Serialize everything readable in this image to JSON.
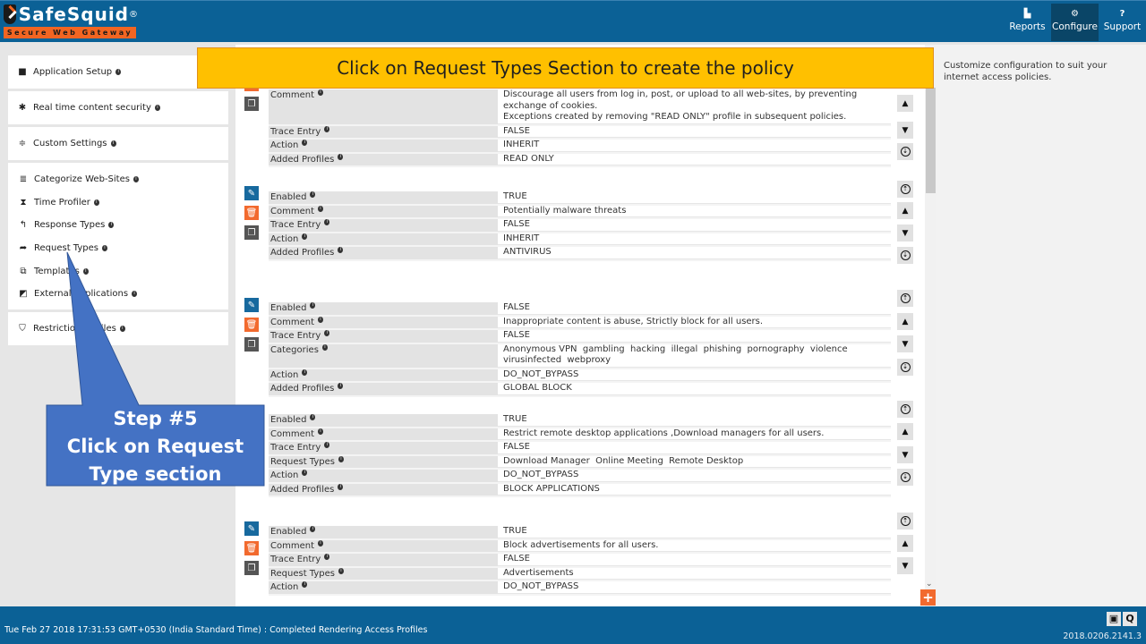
{
  "header": {
    "brand": "SafeSquid",
    "brand_mark": "®",
    "tagline": "Secure Web Gateway",
    "nav": [
      {
        "label": "Reports",
        "icon": "area-chart-icon",
        "glyph": "▙",
        "active": false
      },
      {
        "label": "Configure",
        "icon": "cogs-icon",
        "glyph": "⚙",
        "active": true
      },
      {
        "label": "Support",
        "icon": "question-circle-icon",
        "glyph": "?",
        "active": false
      }
    ]
  },
  "sidebar": {
    "sections": [
      {
        "label": "Application Setup",
        "icon": "briefcase-icon",
        "glyph": "■"
      },
      {
        "label": "Real time content security",
        "icon": "bug-icon",
        "glyph": "✱"
      },
      {
        "label": "Custom Settings",
        "icon": "sliders-icon",
        "glyph": "≑"
      }
    ],
    "sub_items": [
      {
        "label": "Categorize Web-Sites",
        "icon": "database-icon",
        "glyph": "≣"
      },
      {
        "label": "Time Profiler",
        "icon": "hourglass-icon",
        "glyph": "⧗"
      },
      {
        "label": "Response Types",
        "icon": "reply-icon",
        "glyph": "↰"
      },
      {
        "label": "Request Types",
        "icon": "share-icon",
        "glyph": "➦"
      },
      {
        "label": "Templates",
        "icon": "object-group-icon",
        "glyph": "⧉"
      },
      {
        "label": "External applications",
        "icon": "external-link-icon",
        "glyph": "◩"
      }
    ],
    "bottom": {
      "label": "Restriction Profiles",
      "icon": "shield-icon",
      "glyph": "⛉"
    }
  },
  "banner": {
    "text": "Click on Request Types Section to create the policy"
  },
  "callout": {
    "line1": "Step #5",
    "line2": "Click on Request",
    "line3": "Type section"
  },
  "right_panel": {
    "text": "Customize configuration to suit your internet access policies."
  },
  "policies": [
    {
      "rows": [
        {
          "key": "Comment",
          "value": "Discourage all users from log in, post, or upload to all web-sites, by preventing exchange of cookies.\nExceptions created by removing \"READ ONLY\" profile in subsequent policies."
        },
        {
          "key": "Trace Entry",
          "value": "FALSE"
        },
        {
          "key": "Action",
          "value": "INHERIT"
        },
        {
          "key": "Added Profiles",
          "value": "READ ONLY"
        }
      ]
    },
    {
      "rows": [
        {
          "key": "Enabled",
          "value": "TRUE"
        },
        {
          "key": "Comment",
          "value": "Potentially malware threats"
        },
        {
          "key": "Trace Entry",
          "value": "FALSE"
        },
        {
          "key": "Action",
          "value": "INHERIT"
        },
        {
          "key": "Added Profiles",
          "value": "ANTIVIRUS"
        }
      ]
    },
    {
      "rows": [
        {
          "key": "Enabled",
          "value": "FALSE"
        },
        {
          "key": "Comment",
          "value": "Inappropriate content is abuse, Strictly block for all users."
        },
        {
          "key": "Trace Entry",
          "value": "FALSE"
        },
        {
          "key": "Categories",
          "value": "Anonymous VPN  gambling  hacking  illegal  phishing  pornography  violence\nvirusinfected  webproxy"
        },
        {
          "key": "Action",
          "value": "DO_NOT_BYPASS"
        },
        {
          "key": "Added Profiles",
          "value": "GLOBAL BLOCK"
        }
      ]
    },
    {
      "rows": [
        {
          "key": "Enabled",
          "value": "TRUE"
        },
        {
          "key": "Comment",
          "value": "Restrict remote desktop applications ,Download managers for all users."
        },
        {
          "key": "Trace Entry",
          "value": "FALSE"
        },
        {
          "key": "Request Types",
          "value": "Download Manager  Online Meeting  Remote Desktop"
        },
        {
          "key": "Action",
          "value": "DO_NOT_BYPASS"
        },
        {
          "key": "Added Profiles",
          "value": "BLOCK APPLICATIONS"
        }
      ]
    },
    {
      "rows": [
        {
          "key": "Enabled",
          "value": "TRUE"
        },
        {
          "key": "Comment",
          "value": "Block advertisements for all users."
        },
        {
          "key": "Trace Entry",
          "value": "FALSE"
        },
        {
          "key": "Request Types",
          "value": "Advertisements"
        },
        {
          "key": "Action",
          "value": "DO_NOT_BYPASS"
        }
      ]
    }
  ],
  "policy_buttons": {
    "edit": "✎",
    "delete": "🗑",
    "copy": "❐"
  },
  "order_buttons": {
    "top": "⇡",
    "up": "▲",
    "down": "▼",
    "bottom": "⇣"
  },
  "add_button": "+",
  "footer": {
    "status": "Tue Feb 27 2018 17:31:53 GMT+0530 (India Standard Time) : Completed Rendering Access Profiles",
    "version": "2018.0206.2141.3",
    "tools": [
      {
        "name": "save-icon",
        "glyph": "▣"
      },
      {
        "name": "search-icon",
        "glyph": "Q"
      }
    ]
  }
}
